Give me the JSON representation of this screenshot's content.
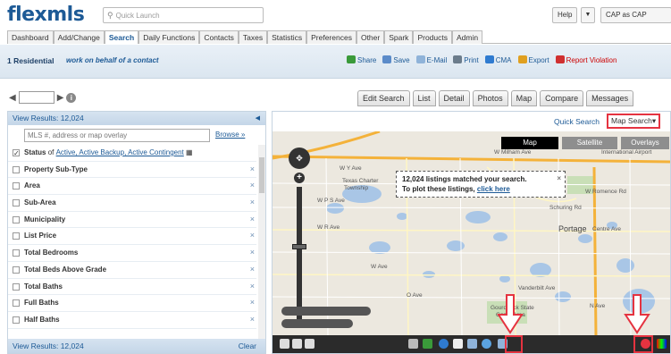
{
  "header": {
    "logo": "flexmls",
    "quick_launch_placeholder": "Quick Launch",
    "help_label": "Help",
    "user_label": "CAP as CAP"
  },
  "nav": {
    "tabs": [
      "Dashboard",
      "Add/Change",
      "Search",
      "Daily Functions",
      "Contacts",
      "Taxes",
      "Statistics",
      "Preferences",
      "Other",
      "Spark",
      "Products",
      "Admin"
    ],
    "active": "Search"
  },
  "context": {
    "title": "1 Residential",
    "subtitle": "work on behalf of a contact",
    "actions": [
      {
        "label": "Share",
        "color": "#3a9a3a"
      },
      {
        "label": "Save",
        "color": "#5b8bc9"
      },
      {
        "label": "E-Mail",
        "color": "#8fb3d9"
      },
      {
        "label": "Print",
        "color": "#6b7c8c"
      },
      {
        "label": "CMA",
        "color": "#2f7bd0"
      },
      {
        "label": "Export",
        "color": "#e0a020"
      },
      {
        "label": "Report Violation",
        "color": "#d03030"
      }
    ]
  },
  "view_tabs": [
    "Edit Search",
    "List",
    "Detail",
    "Photos",
    "Map",
    "Compare",
    "Messages"
  ],
  "left_panel": {
    "header": "View Results: 12,024",
    "search_placeholder": "MLS #, address or map overlay",
    "browse_label": "Browse »",
    "status_label": "Status",
    "status_of": "of",
    "status_values": "Active, Active Backup, Active Contingent",
    "filters": [
      "Property Sub-Type",
      "Area",
      "Sub-Area",
      "Municipality",
      "List Price",
      "Total Bedrooms",
      "Total Beds Above Grade",
      "Total Baths",
      "Full Baths",
      "Half Baths"
    ],
    "footer": "View Results: 12,024",
    "clear_label": "Clear"
  },
  "map_panel": {
    "quick_search": "Quick Search",
    "map_search": "Map Search",
    "map_type_buttons": [
      "Map",
      "Satellite",
      "Overlays"
    ],
    "tooltip_line1": "12,024 listings matched your search.",
    "tooltip_line2": "To plot these listings,",
    "tooltip_link": "click here",
    "labels": {
      "twp1": "Texas Charter",
      "twp2": "Township",
      "portage": "Portage",
      "centre": "Centre Ave",
      "intl": "International Airport",
      "w_milham": "W Milham Ave",
      "vanderbilt": "Vanderbilt Ave",
      "gourdneck1": "Gourdneck State",
      "gourdneck2": "Game Area",
      "romence": "W Romence Rd",
      "schuring": "Schuring Rd",
      "n_ave": "N Ave",
      "o_ave": "O Ave",
      "ps_ave": "W P S Ave",
      "w_ave": "W Ave",
      "y_ave": "W Y Ave",
      "r_ave": "W R Ave"
    }
  }
}
